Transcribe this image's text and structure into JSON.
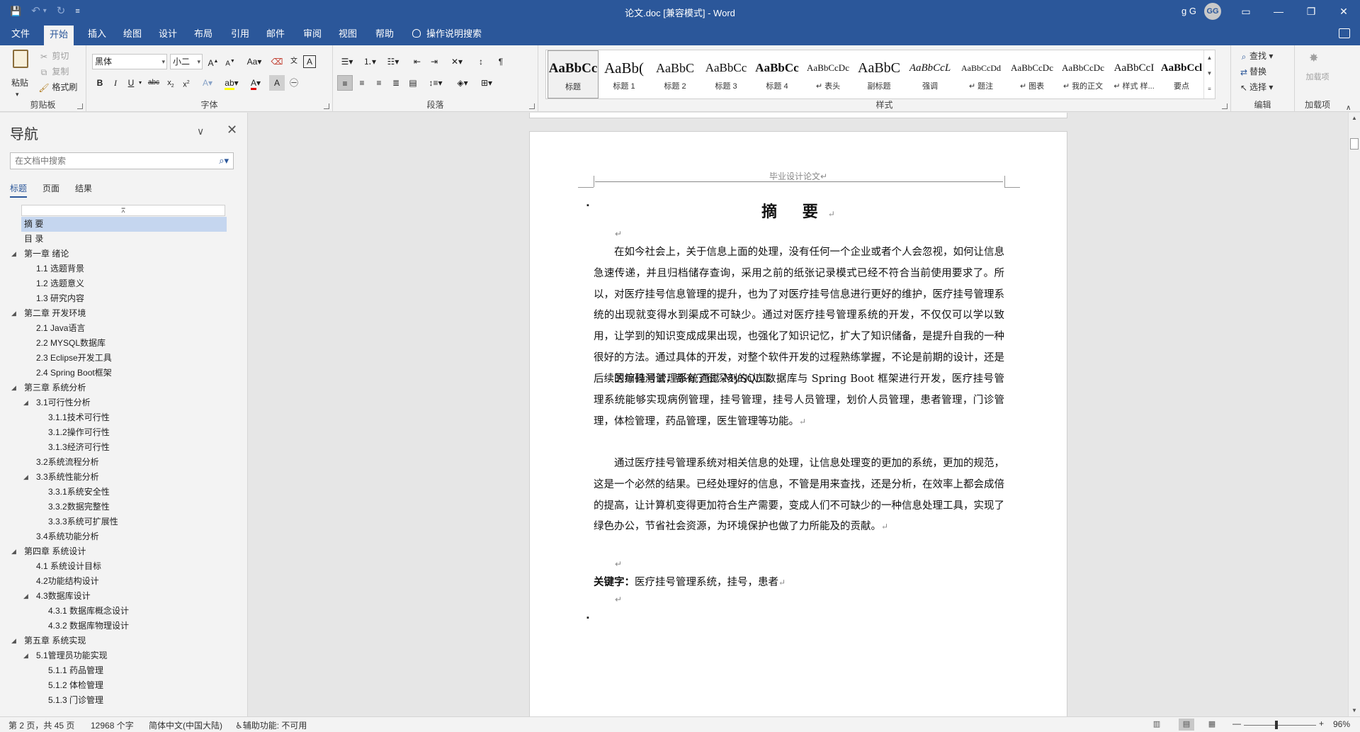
{
  "window": {
    "title": "论文.doc [兼容模式] - Word",
    "user_name": "g G",
    "avatar_initials": "GG",
    "qat": {
      "save": "💾",
      "undo": "↶",
      "undo_drop": "▾",
      "redo": "↻",
      "customize": "≡"
    },
    "controls": {
      "ribbon_display": "▭",
      "minimize": "—",
      "restore": "❐",
      "close": "✕"
    }
  },
  "tabs": [
    "文件",
    "开始",
    "插入",
    "绘图",
    "设计",
    "布局",
    "引用",
    "邮件",
    "审阅",
    "视图",
    "帮助"
  ],
  "active_tab": "开始",
  "tell_me": "操作说明搜索",
  "ribbon": {
    "clipboard": {
      "label": "剪贴板",
      "paste": "粘贴",
      "cut": "剪切",
      "copy": "复制",
      "format_painter": "格式刷"
    },
    "font": {
      "label": "字体",
      "font_name": "黑体",
      "font_size": "小二",
      "aa": "Aa"
    },
    "paragraph": {
      "label": "段落"
    },
    "styles": {
      "label": "样式",
      "items": [
        {
          "preview": "AaBbCc",
          "name": "标题"
        },
        {
          "preview": "AaBb(",
          "name": "标题 1"
        },
        {
          "preview": "AaBbC",
          "name": "标题 2"
        },
        {
          "preview": "AaBbCc",
          "name": "标题 3"
        },
        {
          "preview": "AaBbCc",
          "name": "标题 4"
        },
        {
          "preview": "AaBbCcDc",
          "name": "↵ 表头"
        },
        {
          "preview": "AaBbC",
          "name": "副标题"
        },
        {
          "preview": "AaBbCcL",
          "name": "强调"
        },
        {
          "preview": "AaBbCcDd",
          "name": "↵ 题注"
        },
        {
          "preview": "AaBbCcDc",
          "name": "↵ 图表"
        },
        {
          "preview": "AaBbCcDc",
          "name": "↵ 我的正文"
        },
        {
          "preview": "AaBbCcI",
          "name": "↵ 样式 样..."
        },
        {
          "preview": "AaBbCcl",
          "name": "要点"
        }
      ]
    },
    "editing": {
      "label": "编辑",
      "find": "查找",
      "replace": "替换",
      "select": "选择"
    },
    "addins": {
      "label": "加载项",
      "button": "加载项"
    }
  },
  "nav": {
    "title": "导航",
    "search_placeholder": "在文档中搜索",
    "tabs": [
      "标题",
      "页面",
      "结果"
    ],
    "active_tab": "标题",
    "outline": [
      {
        "text": "摘  要",
        "level": 1,
        "expand": "",
        "selected": true
      },
      {
        "text": "目  录",
        "level": 1,
        "expand": ""
      },
      {
        "text": "第一章 绪论",
        "level": 1,
        "expand": "◢"
      },
      {
        "text": "1.1 选题背景",
        "level": 2,
        "expand": ""
      },
      {
        "text": "1.2 选题意义",
        "level": 2,
        "expand": ""
      },
      {
        "text": "1.3 研究内容",
        "level": 2,
        "expand": ""
      },
      {
        "text": "第二章 开发环境",
        "level": 1,
        "expand": "◢"
      },
      {
        "text": "2.1 Java语言",
        "level": 2,
        "expand": ""
      },
      {
        "text": "2.2 MYSQL数据库",
        "level": 2,
        "expand": ""
      },
      {
        "text": "2.3 Eclipse开发工具",
        "level": 2,
        "expand": ""
      },
      {
        "text": "2.4 Spring Boot框架",
        "level": 2,
        "expand": ""
      },
      {
        "text": "第三章 系统分析",
        "level": 1,
        "expand": "◢"
      },
      {
        "text": "3.1可行性分析",
        "level": 2,
        "expand": "◢"
      },
      {
        "text": "3.1.1技术可行性",
        "level": 3,
        "expand": ""
      },
      {
        "text": "3.1.2操作可行性",
        "level": 3,
        "expand": ""
      },
      {
        "text": "3.1.3经济可行性",
        "level": 3,
        "expand": ""
      },
      {
        "text": "3.2系统流程分析",
        "level": 2,
        "expand": ""
      },
      {
        "text": "3.3系统性能分析",
        "level": 2,
        "expand": "◢"
      },
      {
        "text": "3.3.1系统安全性",
        "level": 3,
        "expand": ""
      },
      {
        "text": "3.3.2数据完整性",
        "level": 3,
        "expand": ""
      },
      {
        "text": "3.3.3系统可扩展性",
        "level": 3,
        "expand": ""
      },
      {
        "text": "3.4系统功能分析",
        "level": 2,
        "expand": ""
      },
      {
        "text": "第四章 系统设计",
        "level": 1,
        "expand": "◢"
      },
      {
        "text": "4.1 系统设计目标",
        "level": 2,
        "expand": ""
      },
      {
        "text": "4.2功能结构设计",
        "level": 2,
        "expand": ""
      },
      {
        "text": "4.3数据库设计",
        "level": 2,
        "expand": "◢"
      },
      {
        "text": "4.3.1 数据库概念设计",
        "level": 3,
        "expand": ""
      },
      {
        "text": "4.3.2 数据库物理设计",
        "level": 3,
        "expand": ""
      },
      {
        "text": "第五章 系统实现",
        "level": 1,
        "expand": "◢"
      },
      {
        "text": "5.1管理员功能实现",
        "level": 2,
        "expand": "◢"
      },
      {
        "text": "5.1.1 药品管理",
        "level": 3,
        "expand": ""
      },
      {
        "text": "5.1.2 体检管理",
        "level": 3,
        "expand": ""
      },
      {
        "text": "5.1.3 门诊管理",
        "level": 3,
        "expand": ""
      }
    ]
  },
  "document": {
    "header": "毕业设计论文↵",
    "title": "摘  要",
    "return_mark": "↵",
    "paragraphs": [
      "在如今社会上，关于信息上面的处理，没有任何一个企业或者个人会忽视，如何让信息急速传递，并且归档储存查询，采用之前的纸张记录模式已经不符合当前使用要求了。所以，对医疗挂号信息管理的提升，也为了对医疗挂号信息进行更好的维护，医疗挂号管理系统的出现就变得水到渠成不可缺少。通过对医疗挂号管理系统的开发，不仅仅可以学以致用，让学到的知识变成成果出现，也强化了知识记忆，扩大了知识储备，是提升自我的一种很好的方法。通过具体的开发，对整个软件开发的过程熟练掌握，不论是前期的设计，还是后续的编码测试，都有了很深刻的认知。",
      "医疗挂号管理系统通过 MySQL 数据库与 Spring Boot 框架进行开发，医疗挂号管理系统能够实现病例管理，挂号管理，挂号人员管理，划价人员管理，患者管理，门诊管理，体检管理，药品管理，医生管理等功能。",
      "通过医疗挂号管理系统对相关信息的处理，让信息处理变的更加的系统，更加的规范，这是一个必然的结果。已经处理好的信息，不管是用来查找，还是分析，在效率上都会成倍的提高，让计算机变得更加符合生产需要，变成人们不可缺少的一种信息处理工具，实现了绿色办公，节省社会资源，为环境保护也做了力所能及的贡献。"
    ],
    "keywords_label": "关键字：",
    "keywords": "医疗挂号管理系统，挂号，患者"
  },
  "status": {
    "page": "第 2 页，共 45 页",
    "words": "12968 个字",
    "language": "简体中文(中国大陆)",
    "accessibility": "辅助功能: 不可用",
    "zoom": "96%",
    "zoom_minus": "—",
    "zoom_plus": "+"
  }
}
